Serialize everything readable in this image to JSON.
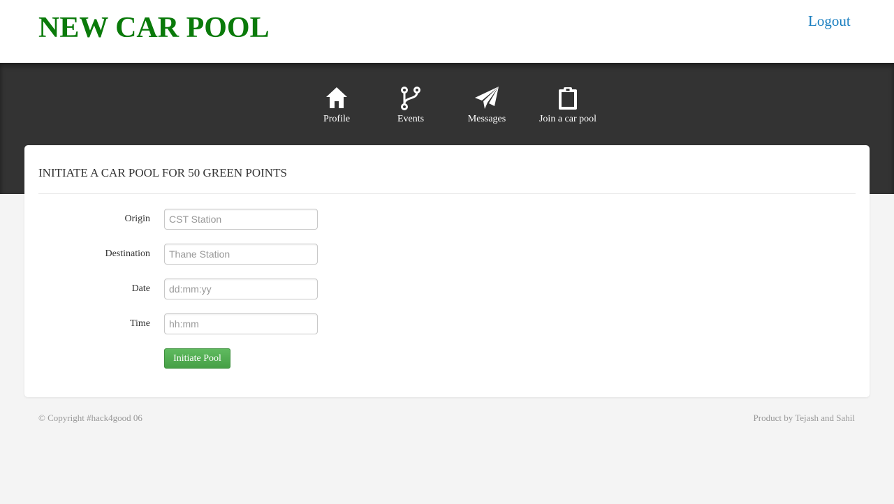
{
  "header": {
    "brand": "NEW CAR POOL",
    "logout_label": "Logout"
  },
  "nav": {
    "items": [
      {
        "label": "Profile",
        "icon": "home-icon"
      },
      {
        "label": "Events",
        "icon": "fork-icon"
      },
      {
        "label": "Messages",
        "icon": "paper-plane-icon"
      },
      {
        "label": "Join a car pool",
        "icon": "clipboard-icon"
      }
    ]
  },
  "panel": {
    "title": "INITIATE A CAR POOL FOR 50 GREEN POINTS",
    "fields": [
      {
        "label": "Origin",
        "placeholder": "CST Station",
        "value": ""
      },
      {
        "label": "Destination",
        "placeholder": "Thane Station",
        "value": ""
      },
      {
        "label": "Date",
        "placeholder": "dd:mm:yy",
        "value": ""
      },
      {
        "label": "Time",
        "placeholder": "hh:mm",
        "value": ""
      }
    ],
    "submit_label": "Initiate Pool"
  },
  "footer": {
    "copyright": "© Copyright #hack4good 06",
    "credit": "Product by Tejash and Sahil"
  },
  "colors": {
    "brand": "#0a7a0a",
    "link": "#1a7fc0",
    "nav_bg": "#333333",
    "button": "#4cae4c"
  }
}
